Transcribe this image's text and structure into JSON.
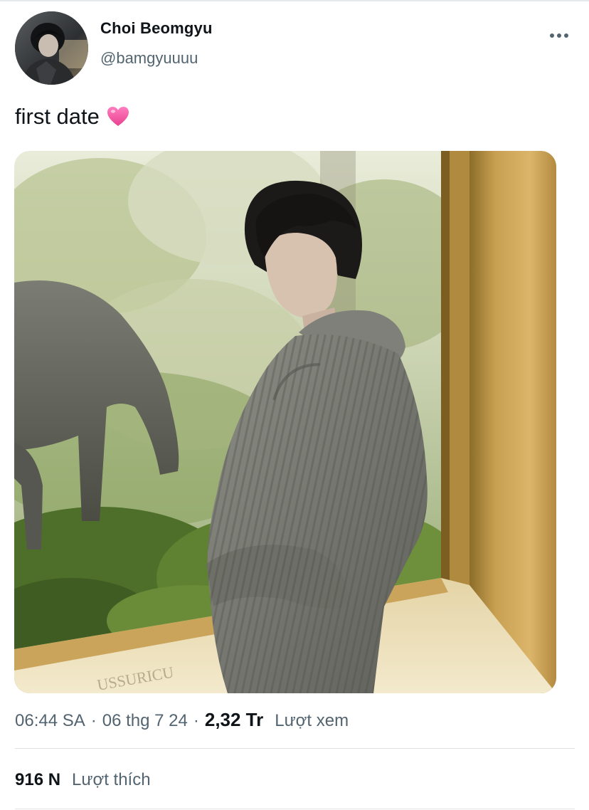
{
  "tweet": {
    "author": {
      "display_name": "Choi Beomgyu",
      "handle": "@bamgyuuuu"
    },
    "more_icon": "more-horizontal-icon",
    "text": "first date",
    "emoji": "pink-heart",
    "media": {
      "type": "photo",
      "engraved_text": "USSURICU"
    },
    "meta": {
      "time": "06:44 SA",
      "separator": "·",
      "date": "06 thg 7 24",
      "views_count": "2,32 Tr",
      "views_label": "Lượt xem"
    },
    "stats": {
      "likes_count": "916 N",
      "likes_label": "Lượt thích"
    }
  },
  "colors": {
    "text_primary": "#0f1419",
    "text_secondary": "#536471",
    "divider": "#dfe3e6",
    "heart": "#f25ca2"
  }
}
